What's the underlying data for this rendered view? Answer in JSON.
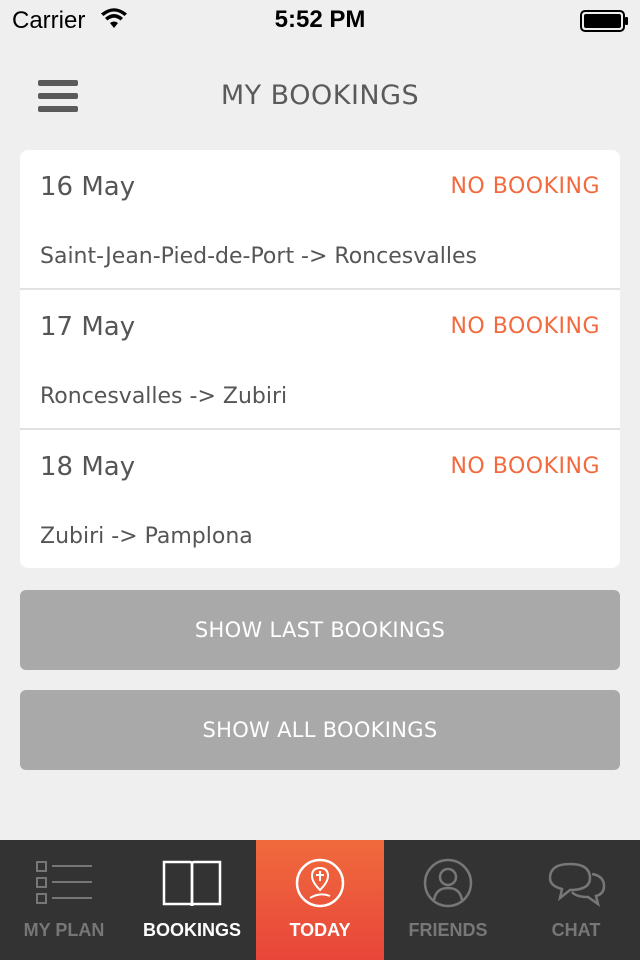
{
  "status_bar": {
    "carrier": "Carrier",
    "time": "5:52 PM"
  },
  "header": {
    "title": "MY BOOKINGS"
  },
  "bookings": [
    {
      "date": "16 May",
      "status": "NO BOOKING",
      "route": "Saint-Jean-Pied-de-Port -> Roncesvalles"
    },
    {
      "date": "17 May",
      "status": "NO BOOKING",
      "route": "Roncesvalles -> Zubiri"
    },
    {
      "date": "18 May",
      "status": "NO BOOKING",
      "route": "Zubiri -> Pamplona"
    }
  ],
  "buttons": {
    "show_last": "SHOW LAST BOOKINGS",
    "show_all": "SHOW ALL BOOKINGS"
  },
  "tabs": [
    {
      "label": "MY PLAN",
      "icon": "list-icon"
    },
    {
      "label": "BOOKINGS",
      "icon": "book-icon"
    },
    {
      "label": "TODAY",
      "icon": "compass-pin-icon"
    },
    {
      "label": "FRIENDS",
      "icon": "person-icon"
    },
    {
      "label": "CHAT",
      "icon": "chat-bubbles-icon"
    }
  ],
  "colors": {
    "accent": "#f26a3d",
    "tab_bar": "#333333",
    "button": "#a9a9a9"
  }
}
